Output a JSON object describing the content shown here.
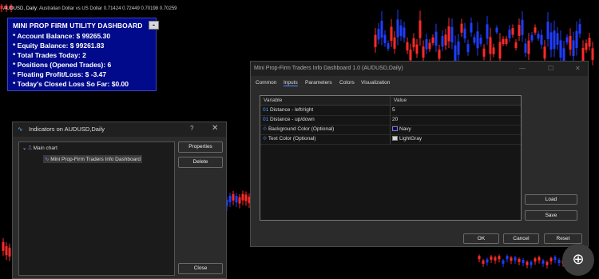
{
  "chart": {
    "header_symbol": "AUDUSD, Daily:",
    "header_desc": "Australian Dollar vs US Dollar",
    "header_prices": "0.71424  0.72449  0.70198  0.70259",
    "colors": {
      "bull": "#1f3dff",
      "bear": "#ff2a2a"
    }
  },
  "dashboard": {
    "title": "MINI PROP FIRM UTILITY DASHBOARD",
    "min_button": "-",
    "lines": [
      "* Account Balance: $ 99265.30",
      "* Equity Balance: $ 99261.83",
      "* Total Trades Today: 2",
      "* Positions (Opened Trades): 6",
      "* Floating Profit/Loss: $ -3.47",
      "* Today's Closed Loss So Far: $0.00"
    ],
    "bg_color": "#000a8a"
  },
  "indicators_window": {
    "title": "Indicators on AUDUSD,Daily",
    "help": "?",
    "close_x": "✕",
    "tree": {
      "root": "Main chart",
      "child": "Mini Prop-Firm Traders Info Dashboard"
    },
    "buttons": {
      "properties": "Properties",
      "delete": "Delete",
      "close": "Close"
    }
  },
  "properties_dialog": {
    "title": "Mini Prop-Firm Traders Info Dashboard 1.0 (AUDUSD,Daily)",
    "tabs": [
      "Common",
      "Inputs",
      "Parameters",
      "Colors",
      "Visualization"
    ],
    "active_tab": "Inputs",
    "columns": [
      "Variable",
      "Value"
    ],
    "rows": [
      {
        "tag": "01",
        "variable": "Distance - left/right",
        "value": "5"
      },
      {
        "tag": "01",
        "variable": "Distance - up/down",
        "value": "20"
      },
      {
        "tag": "⟐",
        "variable": "Background Color (Optional)",
        "value": "Navy",
        "swatch": "#000080"
      },
      {
        "tag": "⟐",
        "variable": "Text Color (Optional)",
        "value": "LightGray",
        "swatch": "#d3d3d3"
      }
    ],
    "buttons": {
      "load": "Load",
      "save": "Save",
      "ok": "OK",
      "cancel": "Cancel",
      "reset": "Reset"
    }
  },
  "zoom_icon": "magnifier-plus-icon"
}
